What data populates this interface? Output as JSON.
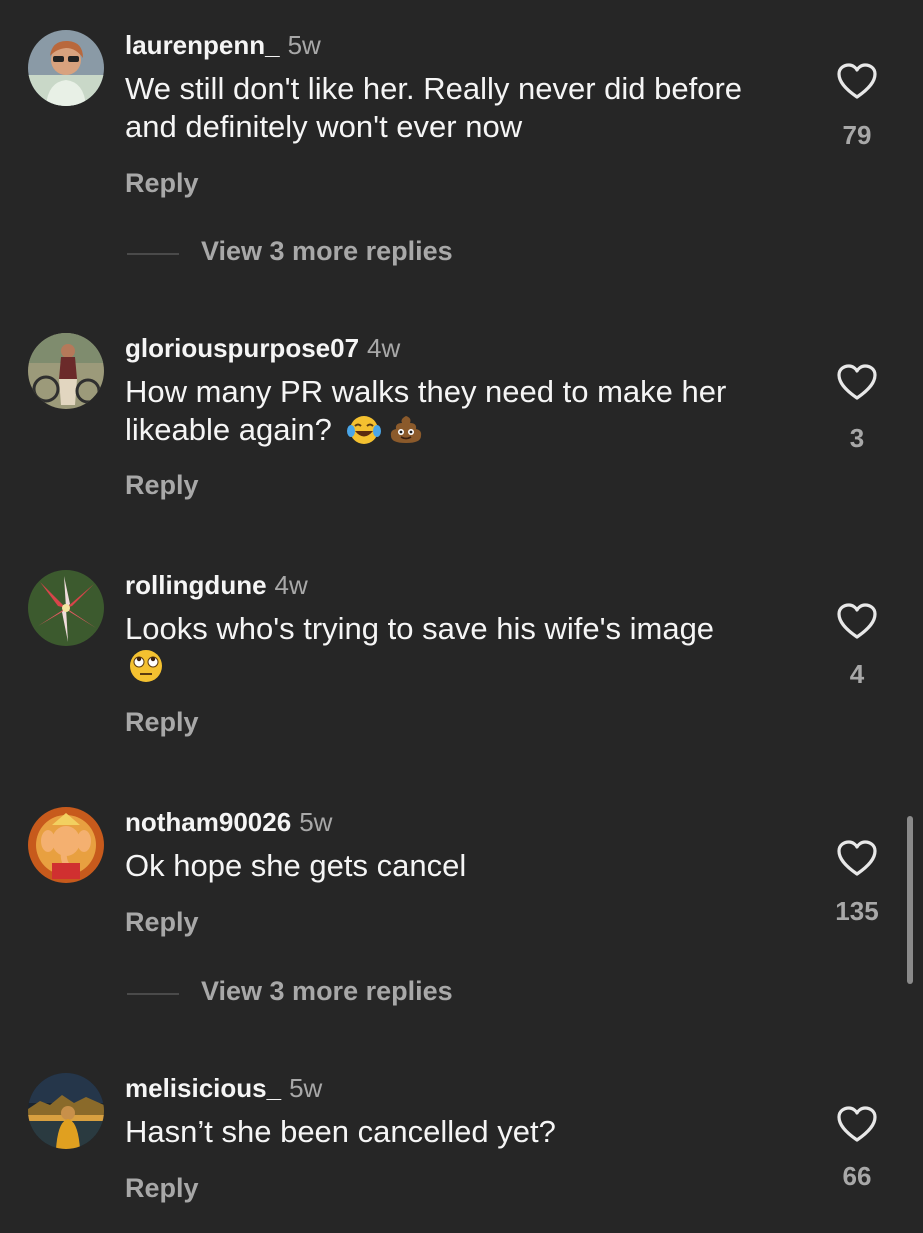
{
  "comments": [
    {
      "username": "laurenpenn_",
      "time": "5w",
      "text": "We still don't like her. Really never did before and definitely won't ever now",
      "emoji": "",
      "reply_label": "Reply",
      "likes": "79",
      "avatar_icon": "profile-photo-woman-sunglasses",
      "view_more": "View 3 more replies"
    },
    {
      "username": "gloriouspurpose07",
      "time": "4w",
      "text": "How many PR walks they need to make her likeable again?",
      "emoji": "😂 💩",
      "reply_label": "Reply",
      "likes": "3",
      "avatar_icon": "profile-photo-woman-with-bike",
      "view_more": ""
    },
    {
      "username": "rollingdune",
      "time": "4w",
      "text": "Looks who's trying to save his wife's image",
      "emoji": "🙄",
      "reply_label": "Reply",
      "likes": "4",
      "avatar_icon": "profile-photo-red-lily-flower",
      "view_more": ""
    },
    {
      "username": "notham90026",
      "time": "5w",
      "text": "Ok hope she gets cancel",
      "emoji": "",
      "reply_label": "Reply",
      "likes": "135",
      "avatar_icon": "profile-photo-ganesha-art",
      "view_more": "View 3 more replies"
    },
    {
      "username": "melisicious_",
      "time": "5w",
      "text": "Hasn’t she been cancelled yet?",
      "emoji": "",
      "reply_label": "Reply",
      "likes": "66",
      "avatar_icon": "profile-photo-night-city-person",
      "view_more": ""
    }
  ],
  "colors": {
    "background": "#262626",
    "primary_text": "#f5f5f5",
    "secondary_text": "#a8a8a8"
  },
  "icons": {
    "like": "heart-outline-icon"
  }
}
